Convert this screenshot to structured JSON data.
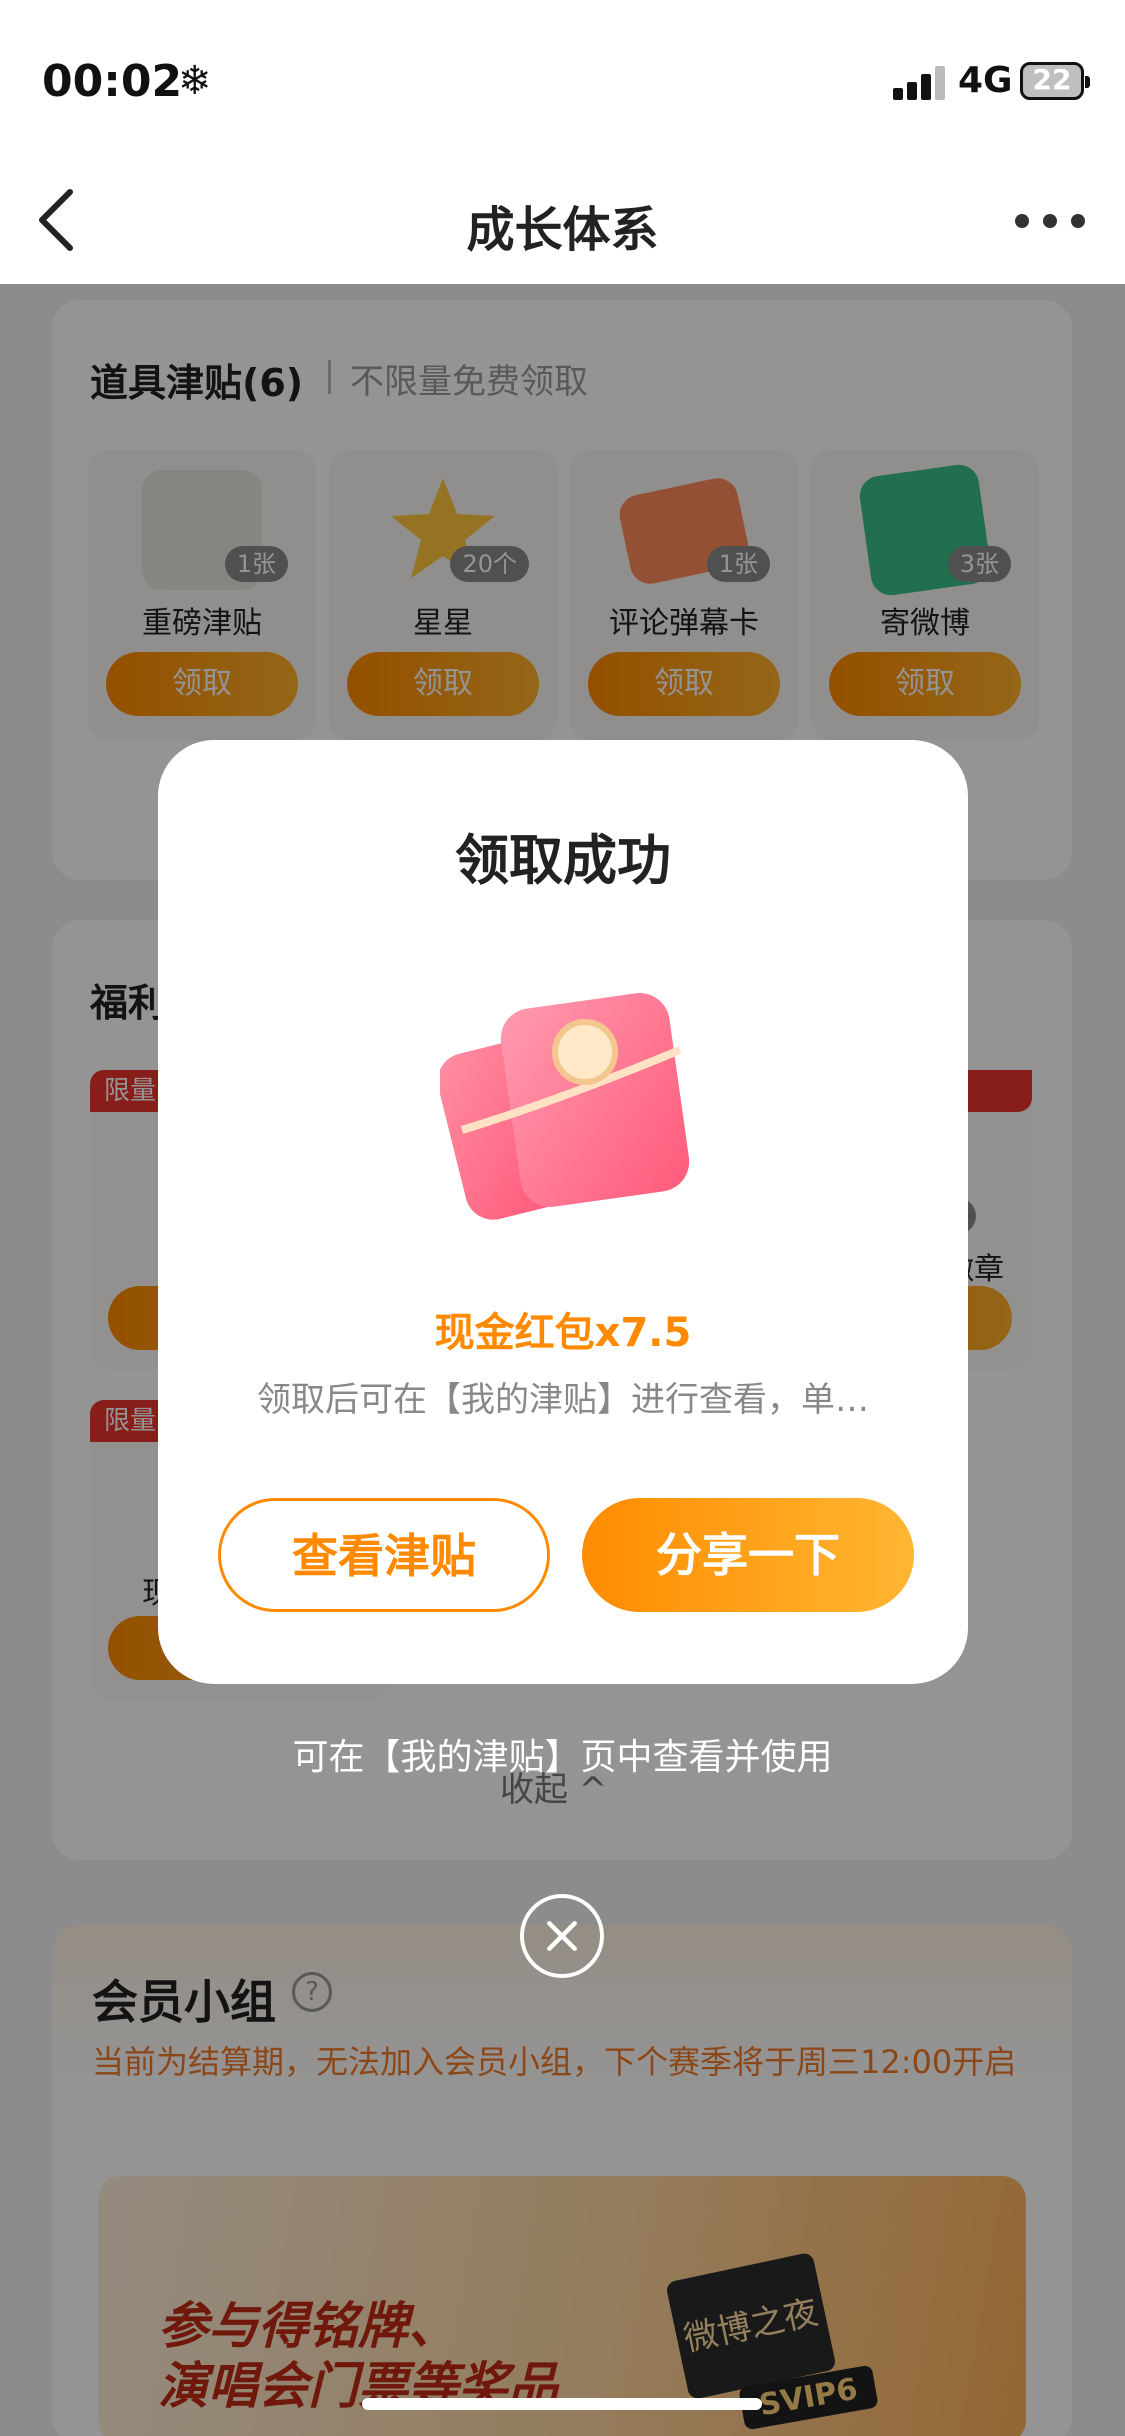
{
  "status_bar": {
    "time": "00:02",
    "weather_icon": "❄",
    "network": "4G",
    "battery": "22"
  },
  "nav": {
    "title": "成长体系"
  },
  "tools": {
    "title": "道具津贴(6)",
    "subtitle": "不限量免费领取",
    "items": [
      {
        "name": "重磅津贴",
        "count": "1张",
        "button": "领取",
        "icon": "camera-icon",
        "color": "#e9e6df"
      },
      {
        "name": "星星",
        "count": "20个",
        "button": "领取",
        "icon": "star-icon",
        "color": "#ffc93c"
      },
      {
        "name": "评论弹幕卡",
        "count": "1张",
        "button": "领取",
        "icon": "comment-card-icon",
        "color": "#ff8a5c"
      },
      {
        "name": "寄微博",
        "count": "3张",
        "button": "领取",
        "icon": "mail-icon",
        "color": "#3bbf8a"
      }
    ]
  },
  "welfare": {
    "title_partial": "福利",
    "tag_label": "限量",
    "right_badge_partial": "个",
    "right_label_partial": "徽章",
    "left_label_partial": "现"
  },
  "bottom_tip": "可在【我的津贴】页中查看并使用",
  "collapse_label": "收起 ^",
  "member": {
    "title": "会员小组",
    "help": "?",
    "desc": "当前为结算期，无法加入会员小组，下个赛季将于周三12:00开启",
    "banner_line1": "参与得铭牌、",
    "banner_line2": "演唱会门票等奖品",
    "banner_badge": "SVIP6",
    "banner_night": "微博之夜"
  },
  "dialog": {
    "title": "领取成功",
    "amount": "现金红包x7.5",
    "desc": "领取后可在【我的津贴】进行查看，单…",
    "view_button": "查看津贴",
    "share_button": "分享一下"
  },
  "colors": {
    "accent": "#ff8a00",
    "tag_red": "#e8352e",
    "envelope": "#ff5a7a"
  }
}
